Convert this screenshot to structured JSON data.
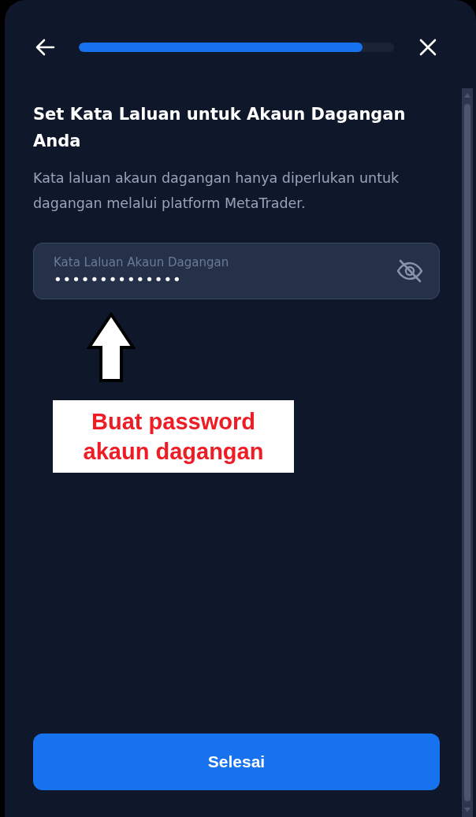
{
  "progress": {
    "level": 0.9
  },
  "title": "Set Kata Laluan untuk Akaun Dagangan Anda",
  "description": "Kata laluan akaun dagangan hanya diperlukan untuk dagangan melalui platform MetaTrader.",
  "password_field": {
    "label": "Kata Laluan Akaun Dagangan",
    "value": "••••••••••••••"
  },
  "annotation": {
    "text": "Buat password akaun dagangan"
  },
  "submit_button": {
    "label": "Selesai"
  }
}
